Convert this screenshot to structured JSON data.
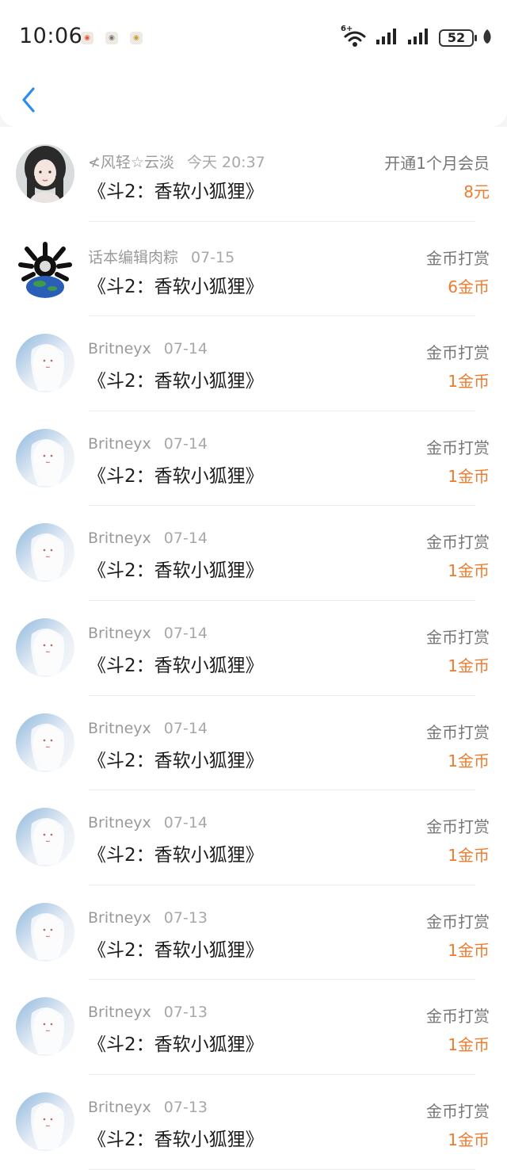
{
  "status_bar": {
    "time": "10:06",
    "battery": "52",
    "network_tag": "6+"
  },
  "items": [
    {
      "name": "≮风轻☆云淡",
      "date": "今天 20:37",
      "title": "《斗2：香软小狐狸》",
      "type": "开通1个月会员",
      "amount": "8元",
      "avatar": "girl"
    },
    {
      "name": "话本编辑肉粽",
      "date": "07-15",
      "title": "《斗2：香软小狐狸》",
      "type": "金币打赏",
      "amount": "6金币",
      "avatar": "globe"
    },
    {
      "name": "Britneyx",
      "date": "07-14",
      "title": "《斗2：香软小狐狸》",
      "type": "金币打赏",
      "amount": "1金币",
      "avatar": "white"
    },
    {
      "name": "Britneyx",
      "date": "07-14",
      "title": "《斗2：香软小狐狸》",
      "type": "金币打赏",
      "amount": "1金币",
      "avatar": "white"
    },
    {
      "name": "Britneyx",
      "date": "07-14",
      "title": "《斗2：香软小狐狸》",
      "type": "金币打赏",
      "amount": "1金币",
      "avatar": "white"
    },
    {
      "name": "Britneyx",
      "date": "07-14",
      "title": "《斗2：香软小狐狸》",
      "type": "金币打赏",
      "amount": "1金币",
      "avatar": "white"
    },
    {
      "name": "Britneyx",
      "date": "07-14",
      "title": "《斗2：香软小狐狸》",
      "type": "金币打赏",
      "amount": "1金币",
      "avatar": "white"
    },
    {
      "name": "Britneyx",
      "date": "07-14",
      "title": "《斗2：香软小狐狸》",
      "type": "金币打赏",
      "amount": "1金币",
      "avatar": "white"
    },
    {
      "name": "Britneyx",
      "date": "07-13",
      "title": "《斗2：香软小狐狸》",
      "type": "金币打赏",
      "amount": "1金币",
      "avatar": "white"
    },
    {
      "name": "Britneyx",
      "date": "07-13",
      "title": "《斗2：香软小狐狸》",
      "type": "金币打赏",
      "amount": "1金币",
      "avatar": "white"
    },
    {
      "name": "Britneyx",
      "date": "07-13",
      "title": "《斗2：香软小狐狸》",
      "type": "金币打赏",
      "amount": "1金币",
      "avatar": "white"
    }
  ],
  "colors": {
    "accent": "#2b8cf0",
    "amount": "#f07b2d"
  }
}
